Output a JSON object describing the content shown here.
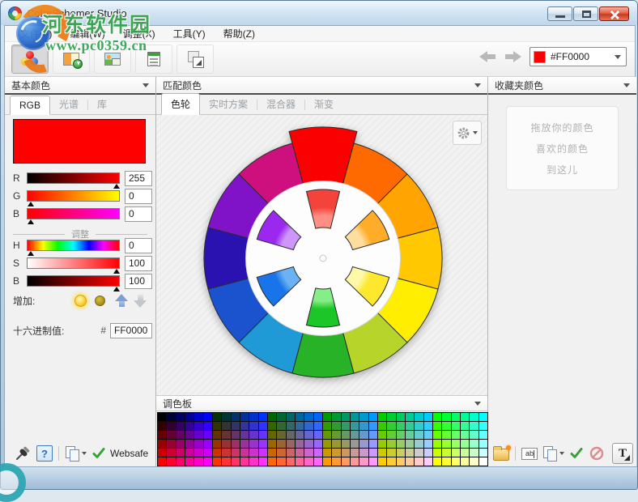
{
  "window": {
    "title": "ColorSchemer Studio"
  },
  "watermark": {
    "site": "河东软件园",
    "url": "www.pc0359.cn"
  },
  "menu": {
    "items": [
      "文件(F)",
      "编辑(W)",
      "调整(X)",
      "工具(Y)",
      "帮助(Z)"
    ]
  },
  "toolbar": {
    "current_color_hex": "#FF0000",
    "current_color_swatch": "#FF0000"
  },
  "left_panel": {
    "header": "基本颜色",
    "tabs": [
      "RGB",
      "光谱",
      "库"
    ],
    "active_tab": "RGB",
    "preview_color": "#FF0000",
    "sliders": {
      "r": {
        "label": "R",
        "value": "255"
      },
      "g": {
        "label": "G",
        "value": "0"
      },
      "b": {
        "label": "B",
        "value": "0"
      },
      "h": {
        "label": "H",
        "value": "0"
      },
      "s": {
        "label": "S",
        "value": "100"
      },
      "v": {
        "label": "B",
        "value": "100"
      }
    },
    "adjust_divider": "调整",
    "increase_label": "增加:",
    "hex_label": "十六进制值:",
    "hex_prefix": "#",
    "hex_value": "FF0000"
  },
  "middle_panel": {
    "header": "匹配颜色",
    "tabs": [
      "色轮",
      "实时方案",
      "混合器",
      "渐变"
    ],
    "active_tab": "色轮",
    "palette_header": "调色板",
    "wheel": {
      "outer_segments": [
        "#FA0000",
        "#FF6A00",
        "#FFA400",
        "#FFC800",
        "#FFEE00",
        "#B6D42A",
        "#28B228",
        "#1F9AD6",
        "#1B52CE",
        "#2A12B0",
        "#8012C8",
        "#CE0F7E"
      ],
      "inner_wedges": [
        {
          "base": "#F4433A",
          "light": "#FF8E84"
        },
        {
          "base": "#FFAD28",
          "light": "#FFDD9E"
        },
        {
          "base": "#FDE82E",
          "light": "#FFF8A8"
        },
        {
          "base": "#1DC628",
          "light": "#86EE86"
        },
        {
          "base": "#1874E8",
          "light": "#6AB2F4"
        },
        {
          "base": "#9A28EE",
          "light": "#CE96F8"
        }
      ]
    },
    "palette_levels": [
      "00",
      "33",
      "66",
      "99",
      "CC",
      "FF"
    ]
  },
  "right_panel": {
    "header": "收藏夹颜色",
    "dropzone_lines": [
      "拖放你的颜色",
      "喜欢的颜色",
      "到这儿"
    ]
  },
  "bottom_bar": {
    "websafe_label": "Websafe",
    "help_glyph": "?",
    "rename_glyph": "ab",
    "text_tool_glyph": "T"
  }
}
